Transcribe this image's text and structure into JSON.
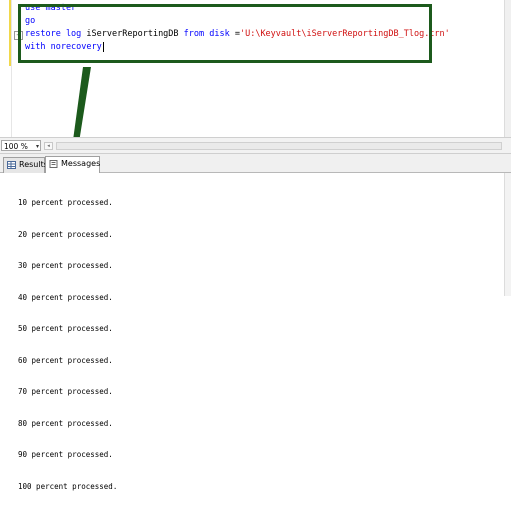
{
  "editor": {
    "lines": [
      [
        {
          "t": "use master",
          "c": "kw"
        }
      ],
      [
        {
          "t": "go",
          "c": "kw"
        }
      ],
      [
        {
          "t": "restore log ",
          "c": "kw"
        },
        {
          "t": "iServerReportingDB ",
          "c": "plain"
        },
        {
          "t": "from disk ",
          "c": "kw"
        },
        {
          "t": "=",
          "c": "plain"
        },
        {
          "t": "'U:\\Keyvault\\iServerReportingDB_Tlog.trn'",
          "c": "str"
        }
      ],
      [
        {
          "t": "with norecovery",
          "c": "kw"
        }
      ]
    ],
    "collapse_symbol": "−"
  },
  "zoombar": {
    "zoom_value": "100 %",
    "dropdown_symbol": "▾"
  },
  "tabs": {
    "results_label": "Results",
    "messages_label": "Messages"
  },
  "messages": [
    "10 percent processed.",
    "20 percent processed.",
    "30 percent processed.",
    "40 percent processed.",
    "50 percent processed.",
    "60 percent processed.",
    "70 percent processed.",
    "80 percent processed.",
    "90 percent processed.",
    "100 percent processed."
  ],
  "colors": {
    "keyword": "#0000ff",
    "string": "#d01010",
    "annotation": "#1c5a1c"
  },
  "icons": {
    "results_tab": "grid-icon",
    "messages_tab": "document-icon"
  }
}
